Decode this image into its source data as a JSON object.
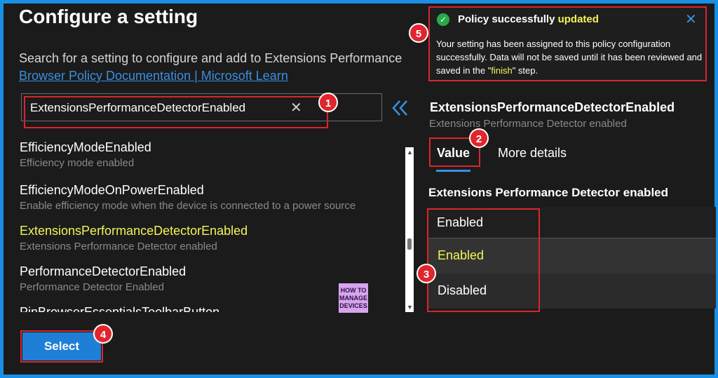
{
  "page": {
    "title": "Configure a setting",
    "description": "Search for a setting to configure and add to Extensions Performance",
    "doc_link": "Browser Policy Documentation | Microsoft Learn"
  },
  "search": {
    "value": "ExtensionsPerformanceDetectorEnabled",
    "clear_icon": "close-icon"
  },
  "settings_list": [
    {
      "name": "EfficiencyModeEnabled",
      "desc": "Efficiency mode enabled",
      "selected": false
    },
    {
      "name": "EfficiencyModeOnPowerEnabled",
      "desc": "Enable efficiency mode when the device is connected to a power source",
      "selected": false
    },
    {
      "name": "ExtensionsPerformanceDetectorEnabled",
      "desc": "Extensions Performance Detector enabled",
      "selected": true
    },
    {
      "name": "PerformanceDetectorEnabled",
      "desc": "Performance Detector Enabled",
      "selected": false
    },
    {
      "name": "PinBrowserEssentialsToolbarButton",
      "desc": "",
      "selected": false
    }
  ],
  "logo": {
    "line1": "HOW TO",
    "line2": "MANAGE",
    "line3": "DEVICES"
  },
  "select_button": "Select",
  "detail": {
    "setting_name": "ExtensionsPerformanceDetectorEnabled",
    "setting_desc": "Extensions Performance Detector enabled",
    "tabs": [
      "Value",
      "More details"
    ],
    "field_label": "Extensions Performance Detector enabled",
    "current_value": "Enabled",
    "options": [
      "Enabled",
      "Disabled"
    ]
  },
  "toast": {
    "title_prefix": "Policy successfully ",
    "title_highlight": "updated",
    "body_prefix": "Your setting has been assigned to this policy configuration successfully. Data will not be saved until it has been reviewed and saved in the \"",
    "body_highlight": "finish",
    "body_suffix": "\" step."
  },
  "callouts": [
    "1",
    "2",
    "3",
    "4",
    "5"
  ],
  "colors": {
    "accent": "#1f7fd6",
    "highlight": "#f2f45a",
    "annotation_red": "#d9262c",
    "success": "#2aa84a"
  }
}
